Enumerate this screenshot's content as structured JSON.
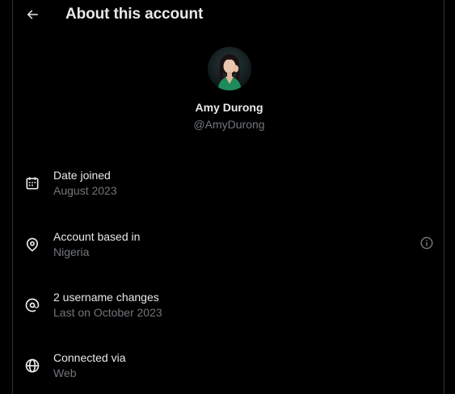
{
  "header": {
    "title": "About this account"
  },
  "profile": {
    "name": "Amy Durong",
    "handle": "@AmyDurong"
  },
  "rows": [
    {
      "label": "Date joined",
      "sub": "August 2023",
      "icon": "calendar-icon"
    },
    {
      "label": "Account based in",
      "sub": "Nigeria",
      "icon": "location-pin-icon"
    },
    {
      "label": "2 username changes",
      "sub": "Last on October 2023",
      "icon": "at-sign-icon"
    },
    {
      "label": "Connected via",
      "sub": "Web",
      "icon": "globe-icon"
    }
  ],
  "colors": {
    "background": "#000000",
    "text_primary": "#e7e9ea",
    "text_secondary": "#71767b",
    "border": "#2f3336"
  }
}
